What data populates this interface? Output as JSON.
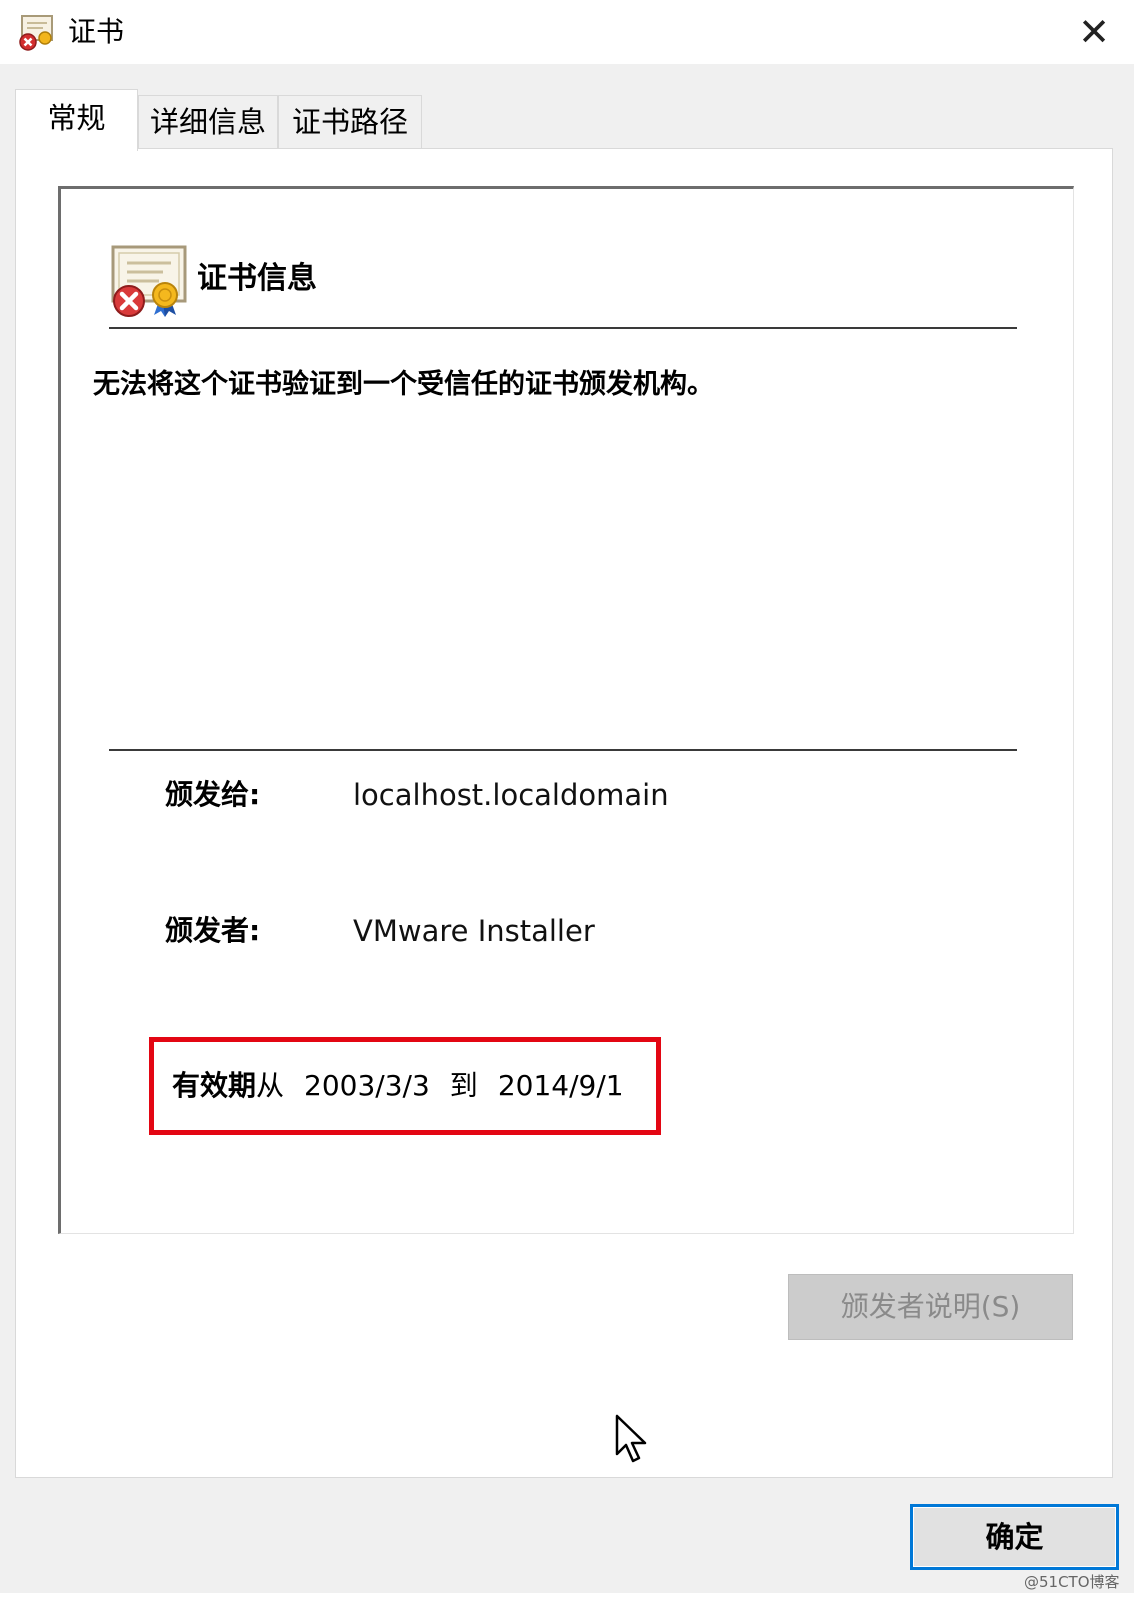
{
  "window": {
    "title": "证书",
    "close_glyph": "✕"
  },
  "tabs": [
    {
      "label": "常规",
      "active": true
    },
    {
      "label": "详细信息",
      "active": false
    },
    {
      "label": "证书路径",
      "active": false
    }
  ],
  "general": {
    "section_title": "证书信息",
    "warning": "无法将这个证书验证到一个受信任的证书颁发机构。",
    "issued_to_label": "颁发给:",
    "issued_to_value": "localhost.localdomain",
    "issued_by_label": "颁发者:",
    "issued_by_value": "VMware Installer",
    "validity": {
      "label_bold": "有效期",
      "from_word": "从",
      "from_date": "2003/3/3",
      "to_word": "到",
      "to_date": "2014/9/1"
    },
    "highlight_color": "#e30613"
  },
  "buttons": {
    "issuer_statement": "颁发者说明(S)",
    "issuer_statement_enabled": false,
    "ok": "确定"
  },
  "watermark": "@51CTO博客",
  "icons": {
    "title": "certificate-error-icon",
    "section": "certificate-error-icon",
    "cursor": "mouse-pointer-icon"
  },
  "colors": {
    "accent": "#0078d7",
    "error_red": "#d32f2f"
  }
}
